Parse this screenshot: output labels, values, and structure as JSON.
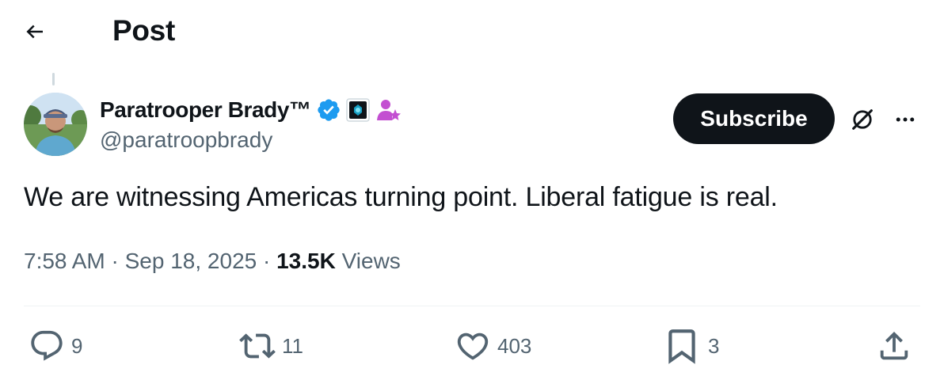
{
  "header": {
    "title": "Post"
  },
  "post": {
    "author": {
      "display_name": "Paratrooper Brady™",
      "handle": "@paratroopbrady"
    },
    "subscribe_label": "Subscribe",
    "text": "We are witnessing Americas turning point. Liberal fatigue is real.",
    "time": "7:58 AM",
    "date": "Sep 18, 2025",
    "views_count": "13.5K",
    "views_label": "Views",
    "separator": "·"
  },
  "actions": {
    "replies": "9",
    "reposts": "11",
    "likes": "403",
    "bookmarks": "3"
  },
  "colors": {
    "verified_blue": "#1d9bf0",
    "subscribe_bg": "#0f1419",
    "secondary_text": "#536471",
    "affiliate_purple": "#c34fd1"
  },
  "icons": {
    "back": "arrow-left-icon",
    "verified": "verified-badge-icon",
    "affiliate": "affiliate-badge-icon",
    "subscriber": "subscriber-star-icon",
    "grok": "grok-icon",
    "more": "more-dots-icon",
    "reply": "reply-icon",
    "repost": "repost-icon",
    "like": "heart-icon",
    "bookmark": "bookmark-icon",
    "share": "share-icon"
  }
}
